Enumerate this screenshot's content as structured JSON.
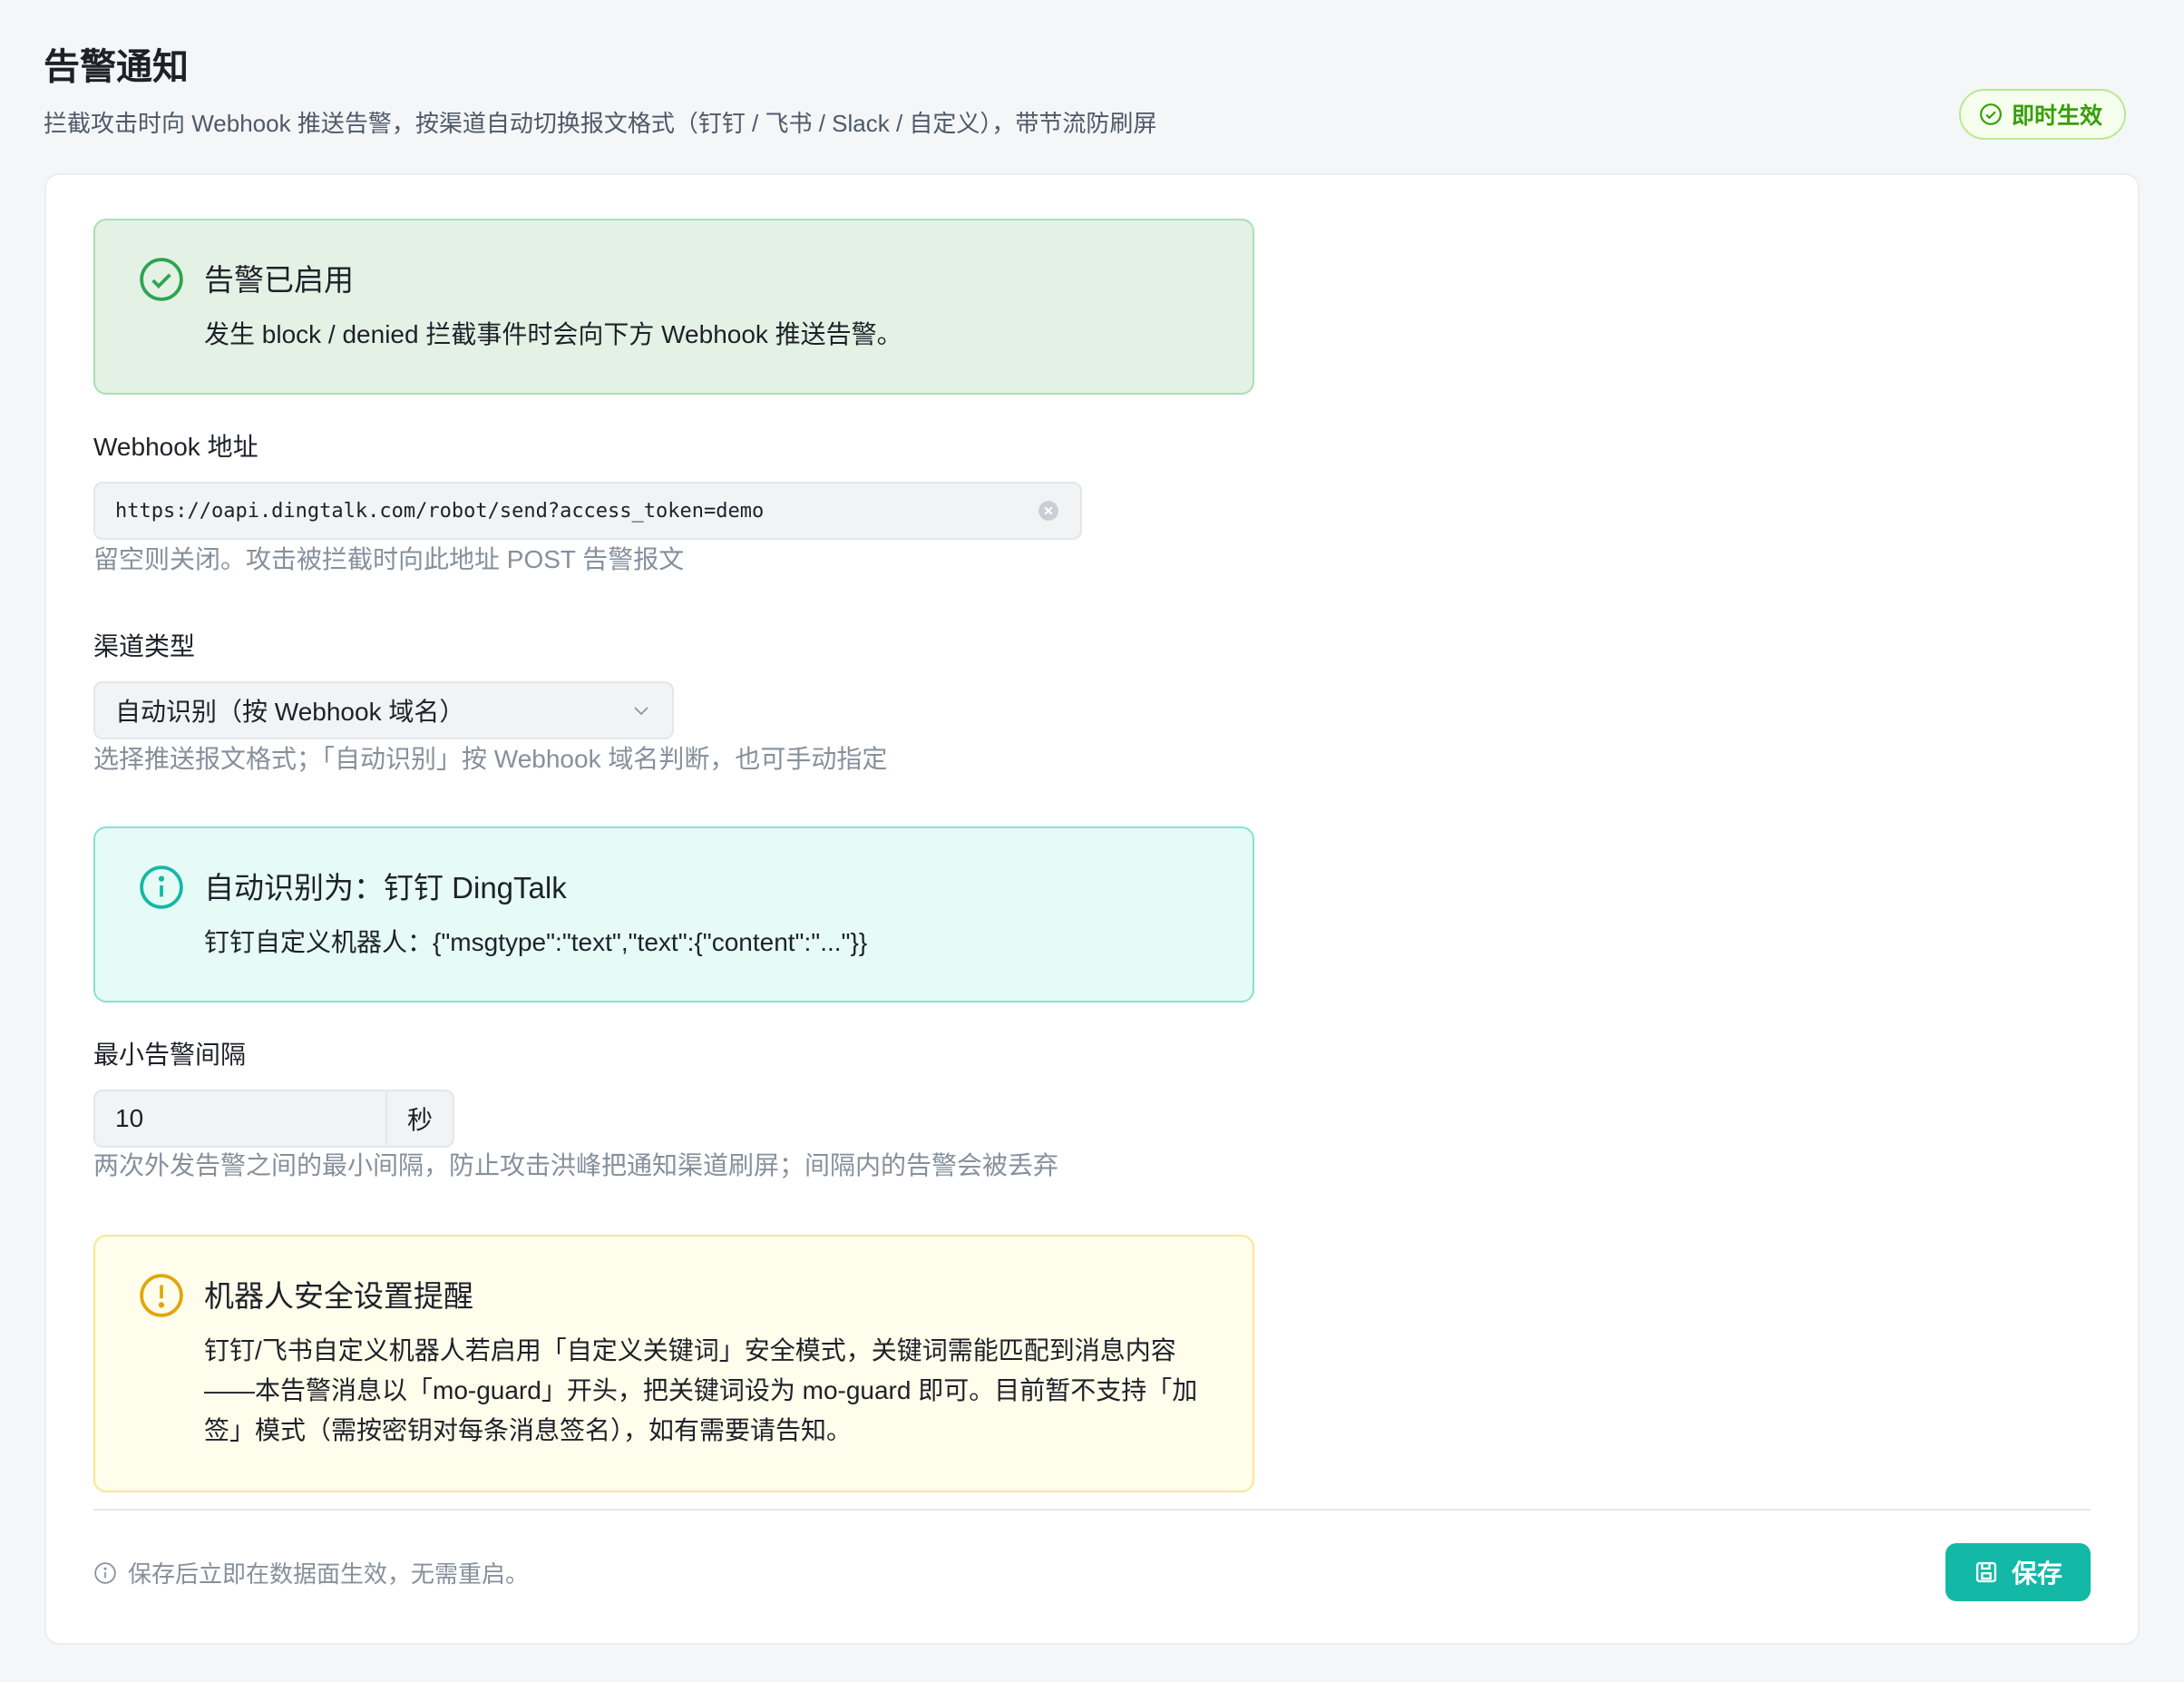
{
  "header": {
    "title": "告警通知",
    "subtitle": "拦截攻击时向 Webhook 推送告警，按渠道自动切换报文格式（钉钉 / 飞书 / Slack / 自定义），带节流防刷屏",
    "badge": "即时生效"
  },
  "status_alert": {
    "title": "告警已启用",
    "desc": "发生 block / denied 拦截事件时会向下方 Webhook 推送告警。"
  },
  "webhook": {
    "label": "Webhook 地址",
    "value": "https://oapi.dingtalk.com/robot/send?access_token=demo",
    "help": "留空则关闭。攻击被拦截时向此地址 POST 告警报文"
  },
  "channel": {
    "label": "渠道类型",
    "selected": "自动识别（按 Webhook 域名）",
    "help": "选择推送报文格式；「自动识别」按 Webhook 域名判断，也可手动指定"
  },
  "detect_alert": {
    "title": "自动识别为：钉钉 DingTalk",
    "desc": "钉钉自定义机器人：{\"msgtype\":\"text\",\"text\":{\"content\":\"...\"}}"
  },
  "interval": {
    "label": "最小告警间隔",
    "value": "10",
    "unit": "秒",
    "help": "两次外发告警之间的最小间隔，防止攻击洪峰把通知渠道刷屏；间隔内的告警会被丢弃"
  },
  "warn_alert": {
    "title": "机器人安全设置提醒",
    "desc_line1": "钉钉/飞书自定义机器人若启用「自定义关键词」安全模式，关键词需能匹配到消息内容",
    "desc_line2": "——本告警消息以「mo-guard」开头，把关键词设为 mo-guard 即可。目前暂不支持「加",
    "desc_line3": "签」模式（需按密钥对每条消息签名），如有需要请告知。"
  },
  "footer": {
    "note": "保存后立即在数据面生效，无需重启。",
    "save_label": "保存"
  },
  "colors": {
    "primary": "#14b8a6",
    "success": "#52c41a",
    "info": "#14b8a6",
    "warning": "#faad14"
  }
}
